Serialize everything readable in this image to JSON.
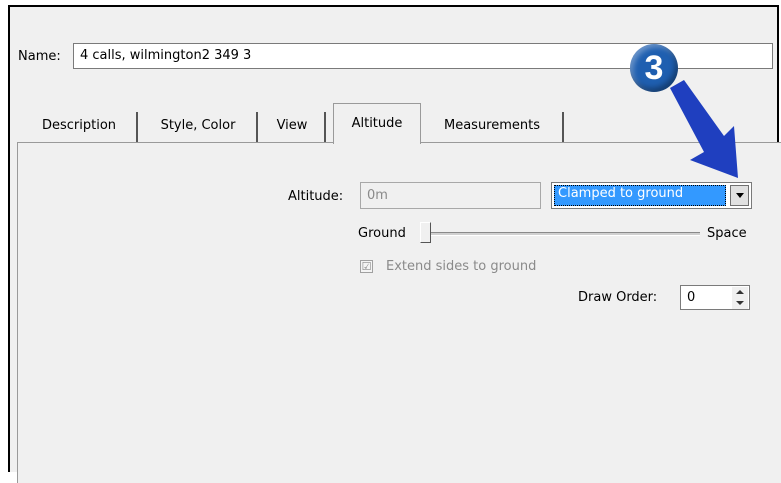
{
  "name": {
    "label": "Name:",
    "value": "4 calls, wilmington2 349 3"
  },
  "tabs": [
    {
      "label": "Description"
    },
    {
      "label": "Style, Color"
    },
    {
      "label": "View"
    },
    {
      "label": "Altitude",
      "active": true
    },
    {
      "label": "Measurements"
    }
  ],
  "altitude": {
    "label": "Altitude:",
    "value": "0m",
    "mode": "Clamped to ground"
  },
  "slider": {
    "left_label": "Ground",
    "right_label": "Space",
    "level": 0
  },
  "extend": {
    "label": "Extend sides to ground",
    "checked": true,
    "check_glyph": "☑"
  },
  "draw_order": {
    "label": "Draw Order:",
    "value": "0"
  },
  "callout": {
    "number": "3",
    "color": "#1f5fb0",
    "arrow_color": "#1f3fbf"
  },
  "colors": {
    "panel": "#f0f0f0",
    "selection": "#3399ff"
  }
}
